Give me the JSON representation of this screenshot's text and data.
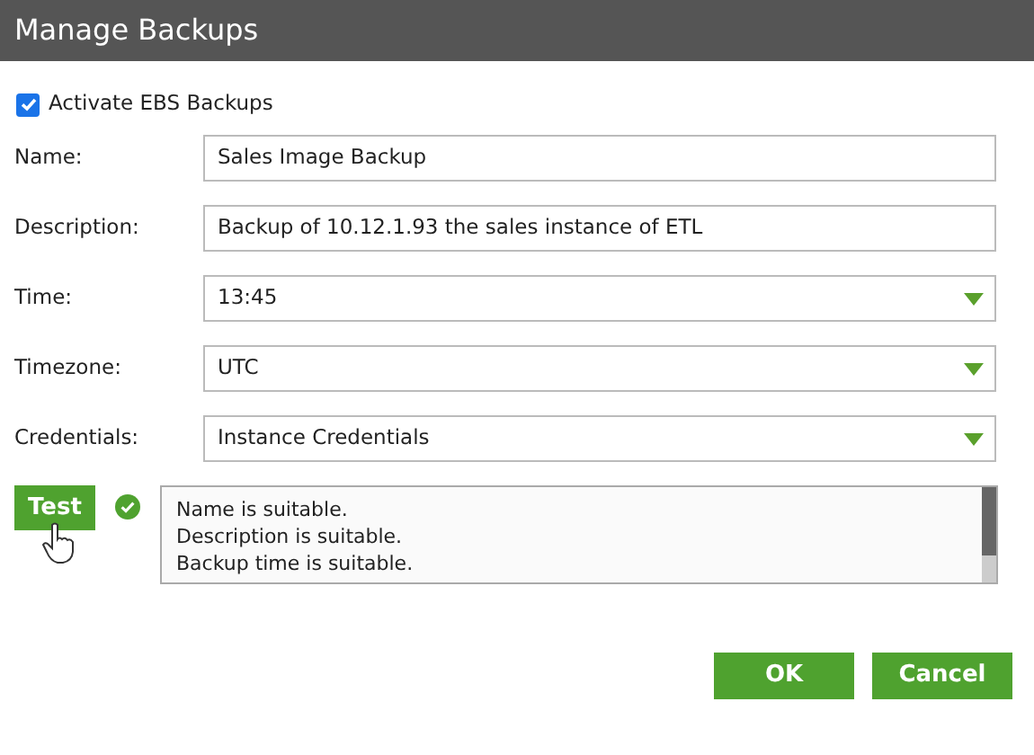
{
  "window": {
    "title": "Manage Backups"
  },
  "activate": {
    "label": "Activate EBS Backups",
    "checked": true
  },
  "fields": [
    {
      "label": "Name:",
      "kind": "text",
      "value": "Sales Image Backup"
    },
    {
      "label": "Description:",
      "kind": "text",
      "value": "Backup of 10.12.1.93 the sales instance of ETL"
    },
    {
      "label": "Time:",
      "kind": "select",
      "value": "13:45"
    },
    {
      "label": "Timezone:",
      "kind": "select",
      "value": "UTC"
    },
    {
      "label": "Credentials:",
      "kind": "select",
      "value": "Instance Credentials"
    }
  ],
  "test": {
    "button": "Test",
    "passed": true,
    "log": [
      "Name is suitable.",
      "Description is suitable.",
      "Backup time is suitable."
    ]
  },
  "buttons": [
    "OK",
    "Cancel"
  ]
}
